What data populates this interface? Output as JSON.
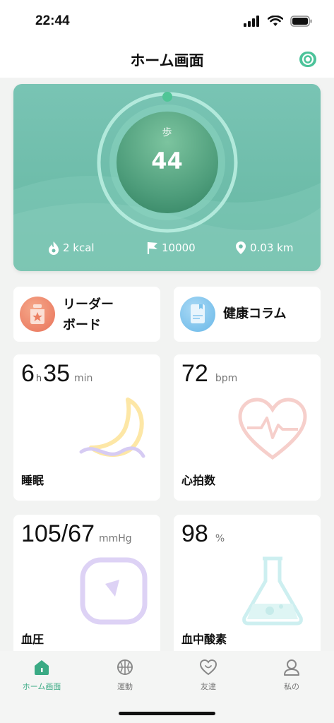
{
  "status": {
    "time": "22:44"
  },
  "header": {
    "title": "ホーム画面",
    "watch_icon": "watch-icon"
  },
  "hero": {
    "steps_label": "歩",
    "steps_value": "44",
    "calories": "2 kcal",
    "goal": "10000",
    "distance": "0.03 km",
    "colors": {
      "background": "#6dbca9",
      "ring": "#a9e4d2",
      "ball": "#3f9a79"
    }
  },
  "shortcuts": [
    {
      "label_line1": "リーダー",
      "label_line2": "ボード",
      "icon": "trophy-jar-icon"
    },
    {
      "label": "健康コラム",
      "icon": "article-icon"
    }
  ],
  "metrics": {
    "sleep": {
      "hours": "6",
      "h_unit": "h",
      "minutes": "35",
      "min_unit": "min",
      "name": "睡眠"
    },
    "heart": {
      "value": "72",
      "unit": "bpm",
      "name": "心拍数"
    },
    "pressure": {
      "value": "105/67",
      "unit": "mmHg",
      "name": "血圧"
    },
    "oxygen": {
      "value": "98",
      "unit": "%",
      "name": "血中酸素"
    }
  },
  "tabs": [
    {
      "label": "ホーム画面",
      "icon": "home-icon",
      "active": true
    },
    {
      "label": "運動",
      "icon": "basketball-icon",
      "active": false
    },
    {
      "label": "友達",
      "icon": "friend-heart-icon",
      "active": false
    },
    {
      "label": "私の",
      "icon": "user-icon",
      "active": false
    }
  ],
  "accent": "#3aaa84"
}
